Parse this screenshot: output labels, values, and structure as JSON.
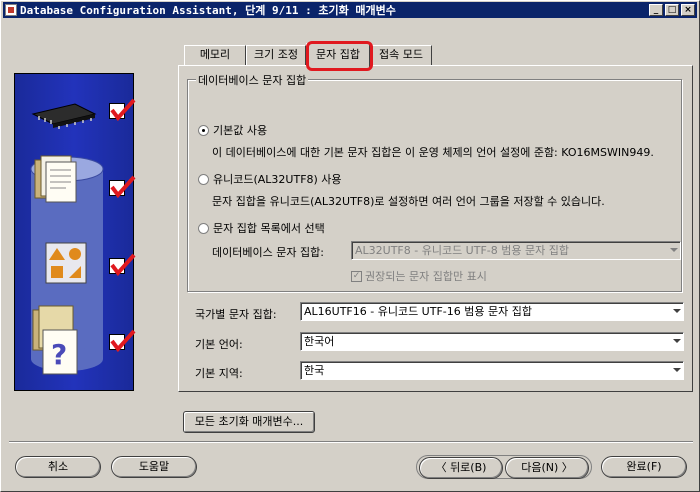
{
  "window": {
    "title": "Database Configuration Assistant, 단계 9/11 : 초기화 매개변수"
  },
  "titlebar_buttons": {
    "minimize": "_",
    "maximize": "□",
    "close": "×"
  },
  "tabs": [
    {
      "label": "메모리"
    },
    {
      "label": "크기 조정"
    },
    {
      "label": "문자 집합"
    },
    {
      "label": "접속 모드"
    }
  ],
  "charset_group": {
    "legend": "데이터베이스 문자 집합",
    "option_default": {
      "label": "기본값 사용",
      "desc": "이 데이터베이스에 대한 기본 문자 집합은 이 운영 체제의 언어 설정에 준함: KO16MSWIN949."
    },
    "option_unicode": {
      "label": "유니코드(AL32UTF8) 사용",
      "desc": "문자 집합을 유니코드(AL32UTF8)로 설정하면 여러 언어 그룹을 저장할 수 있습니다."
    },
    "option_list": {
      "label": "문자 집합 목록에서 선택"
    },
    "db_charset_label": "데이터베이스 문자 집합:",
    "db_charset_value": "AL32UTF8 - 유니코드 UTF-8 범용 문자 집합",
    "recommended_only": "권장되는 문자 집합만 표시",
    "check_mark": "✓"
  },
  "national_charset": {
    "label": "국가별 문자 집합:",
    "value": "AL16UTF16 - 유니코드 UTF-16 범용 문자 집합"
  },
  "default_language": {
    "label": "기본 언어:",
    "value": "한국어"
  },
  "default_territory": {
    "label": "기본 지역:",
    "value": "한국"
  },
  "all_params_button": "모든 초기화 매개변수...",
  "footer": {
    "cancel": "취소",
    "help": "도움말",
    "back": "뒤로(B)",
    "next": "다음(N)",
    "finish": "완료(F)"
  },
  "colors": {
    "titlebar": "#0a246a",
    "highlight": "#e0191f",
    "illustration": "#2233bb",
    "check": "#e0191f"
  }
}
